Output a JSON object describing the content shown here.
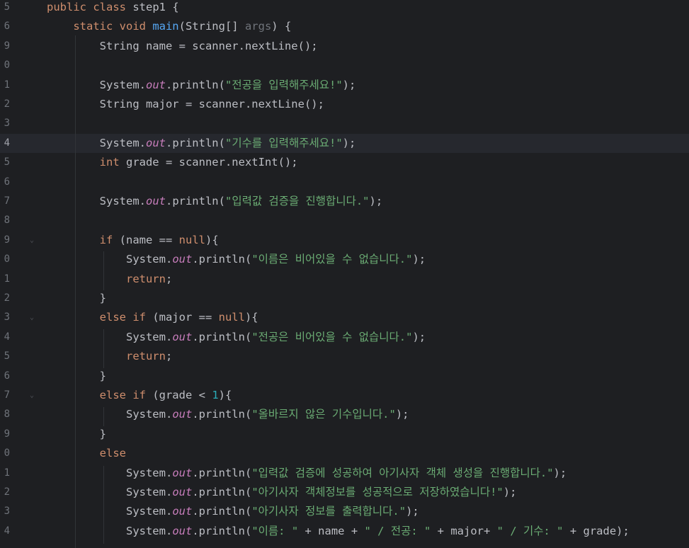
{
  "editor": {
    "colors": {
      "background": "#1e1f22",
      "keyword": "#cf8e6d",
      "method_decl": "#56a8f5",
      "static_field": "#c77dbb",
      "string": "#6aab73",
      "number": "#2aacb8",
      "unused_param": "#6f737a",
      "text": "#bcbec4",
      "line_number": "#6f737a",
      "current_line": "#26282e"
    },
    "current_line_number": "4",
    "lines": [
      {
        "ln": "5",
        "fold": false,
        "tokens": [
          {
            "t": "public class ",
            "c": "kw"
          },
          {
            "t": "step1 {",
            "c": "plain"
          }
        ]
      },
      {
        "ln": "6",
        "fold": false,
        "tokens": [
          {
            "t": "    static void ",
            "c": "kw"
          },
          {
            "t": "main",
            "c": "fn"
          },
          {
            "t": "(String[] ",
            "c": "plain"
          },
          {
            "t": "args",
            "c": "param"
          },
          {
            "t": ") {",
            "c": "plain"
          }
        ]
      },
      {
        "ln": "9",
        "fold": false,
        "tokens": [
          {
            "t": "        String name = scanner.nextLine();",
            "c": "plain"
          }
        ]
      },
      {
        "ln": "0",
        "fold": false,
        "tokens": []
      },
      {
        "ln": "1",
        "fold": false,
        "tokens": [
          {
            "t": "        System.",
            "c": "plain"
          },
          {
            "t": "out",
            "c": "fld"
          },
          {
            "t": ".println(",
            "c": "plain"
          },
          {
            "t": "\"전공을 입력해주세요!\"",
            "c": "str"
          },
          {
            "t": ");",
            "c": "plain"
          }
        ]
      },
      {
        "ln": "2",
        "fold": false,
        "tokens": [
          {
            "t": "        String major = scanner.nextLine();",
            "c": "plain"
          }
        ]
      },
      {
        "ln": "3",
        "fold": false,
        "tokens": []
      },
      {
        "ln": "4",
        "fold": false,
        "tokens": [
          {
            "t": "        System.",
            "c": "plain"
          },
          {
            "t": "out",
            "c": "fld"
          },
          {
            "t": ".println(",
            "c": "plain"
          },
          {
            "t": "\"기수를 입력해주세요!\"",
            "c": "str"
          },
          {
            "t": ");",
            "c": "plain"
          }
        ]
      },
      {
        "ln": "5",
        "fold": false,
        "tokens": [
          {
            "t": "        ",
            "c": "plain"
          },
          {
            "t": "int ",
            "c": "kw"
          },
          {
            "t": "grade = scanner.nextInt();",
            "c": "plain"
          }
        ]
      },
      {
        "ln": "6",
        "fold": false,
        "tokens": []
      },
      {
        "ln": "7",
        "fold": false,
        "tokens": [
          {
            "t": "        System.",
            "c": "plain"
          },
          {
            "t": "out",
            "c": "fld"
          },
          {
            "t": ".println(",
            "c": "plain"
          },
          {
            "t": "\"입력값 검증을 진행합니다.\"",
            "c": "str"
          },
          {
            "t": ");",
            "c": "plain"
          }
        ]
      },
      {
        "ln": "8",
        "fold": false,
        "tokens": []
      },
      {
        "ln": "9",
        "fold": true,
        "tokens": [
          {
            "t": "        ",
            "c": "plain"
          },
          {
            "t": "if ",
            "c": "kw"
          },
          {
            "t": "(name == ",
            "c": "plain"
          },
          {
            "t": "null",
            "c": "kw"
          },
          {
            "t": "){",
            "c": "plain"
          }
        ]
      },
      {
        "ln": "0",
        "fold": false,
        "tokens": [
          {
            "t": "            System.",
            "c": "plain"
          },
          {
            "t": "out",
            "c": "fld"
          },
          {
            "t": ".println(",
            "c": "plain"
          },
          {
            "t": "\"이름은 비어있을 수 없습니다.\"",
            "c": "str"
          },
          {
            "t": ");",
            "c": "plain"
          }
        ]
      },
      {
        "ln": "1",
        "fold": false,
        "tokens": [
          {
            "t": "            ",
            "c": "plain"
          },
          {
            "t": "return",
            "c": "kw"
          },
          {
            "t": ";",
            "c": "plain"
          }
        ]
      },
      {
        "ln": "2",
        "fold": false,
        "tokens": [
          {
            "t": "        }",
            "c": "plain"
          }
        ]
      },
      {
        "ln": "3",
        "fold": true,
        "tokens": [
          {
            "t": "        ",
            "c": "plain"
          },
          {
            "t": "else if ",
            "c": "kw"
          },
          {
            "t": "(major == ",
            "c": "plain"
          },
          {
            "t": "null",
            "c": "kw"
          },
          {
            "t": "){",
            "c": "plain"
          }
        ]
      },
      {
        "ln": "4",
        "fold": false,
        "tokens": [
          {
            "t": "            System.",
            "c": "plain"
          },
          {
            "t": "out",
            "c": "fld"
          },
          {
            "t": ".println(",
            "c": "plain"
          },
          {
            "t": "\"전공은 비어있을 수 없습니다.\"",
            "c": "str"
          },
          {
            "t": ");",
            "c": "plain"
          }
        ]
      },
      {
        "ln": "5",
        "fold": false,
        "tokens": [
          {
            "t": "            ",
            "c": "plain"
          },
          {
            "t": "return",
            "c": "kw"
          },
          {
            "t": ";",
            "c": "plain"
          }
        ]
      },
      {
        "ln": "6",
        "fold": false,
        "tokens": [
          {
            "t": "        }",
            "c": "plain"
          }
        ]
      },
      {
        "ln": "7",
        "fold": true,
        "tokens": [
          {
            "t": "        ",
            "c": "plain"
          },
          {
            "t": "else if ",
            "c": "kw"
          },
          {
            "t": "(grade < ",
            "c": "plain"
          },
          {
            "t": "1",
            "c": "num"
          },
          {
            "t": "){",
            "c": "plain"
          }
        ]
      },
      {
        "ln": "8",
        "fold": false,
        "tokens": [
          {
            "t": "            System.",
            "c": "plain"
          },
          {
            "t": "out",
            "c": "fld"
          },
          {
            "t": ".println(",
            "c": "plain"
          },
          {
            "t": "\"올바르지 않은 기수입니다.\"",
            "c": "str"
          },
          {
            "t": ");",
            "c": "plain"
          }
        ]
      },
      {
        "ln": "9",
        "fold": false,
        "tokens": [
          {
            "t": "        }",
            "c": "plain"
          }
        ]
      },
      {
        "ln": "0",
        "fold": false,
        "tokens": [
          {
            "t": "        ",
            "c": "plain"
          },
          {
            "t": "else",
            "c": "kw"
          }
        ]
      },
      {
        "ln": "1",
        "fold": false,
        "tokens": [
          {
            "t": "            System.",
            "c": "plain"
          },
          {
            "t": "out",
            "c": "fld"
          },
          {
            "t": ".println(",
            "c": "plain"
          },
          {
            "t": "\"입력값 검증에 성공하여 아기사자 객체 생성을 진행합니다.\"",
            "c": "str"
          },
          {
            "t": ");",
            "c": "plain"
          }
        ]
      },
      {
        "ln": "2",
        "fold": false,
        "tokens": [
          {
            "t": "            System.",
            "c": "plain"
          },
          {
            "t": "out",
            "c": "fld"
          },
          {
            "t": ".println(",
            "c": "plain"
          },
          {
            "t": "\"아기사자 객체정보를 성공적으로 저장하였습니다!\"",
            "c": "str"
          },
          {
            "t": ");",
            "c": "plain"
          }
        ]
      },
      {
        "ln": "3",
        "fold": false,
        "tokens": [
          {
            "t": "            System.",
            "c": "plain"
          },
          {
            "t": "out",
            "c": "fld"
          },
          {
            "t": ".println(",
            "c": "plain"
          },
          {
            "t": "\"아기사자 정보를 출력합니다.\"",
            "c": "str"
          },
          {
            "t": ");",
            "c": "plain"
          }
        ]
      },
      {
        "ln": "4",
        "fold": false,
        "tokens": [
          {
            "t": "            System.",
            "c": "plain"
          },
          {
            "t": "out",
            "c": "fld"
          },
          {
            "t": ".println(",
            "c": "plain"
          },
          {
            "t": "\"이름: \"",
            "c": "str"
          },
          {
            "t": " + name + ",
            "c": "plain"
          },
          {
            "t": "\" / 전공: \"",
            "c": "str"
          },
          {
            "t": " + major+ ",
            "c": "plain"
          },
          {
            "t": "\" / 기수: \"",
            "c": "str"
          },
          {
            "t": " + grade);",
            "c": "plain"
          }
        ]
      }
    ]
  }
}
